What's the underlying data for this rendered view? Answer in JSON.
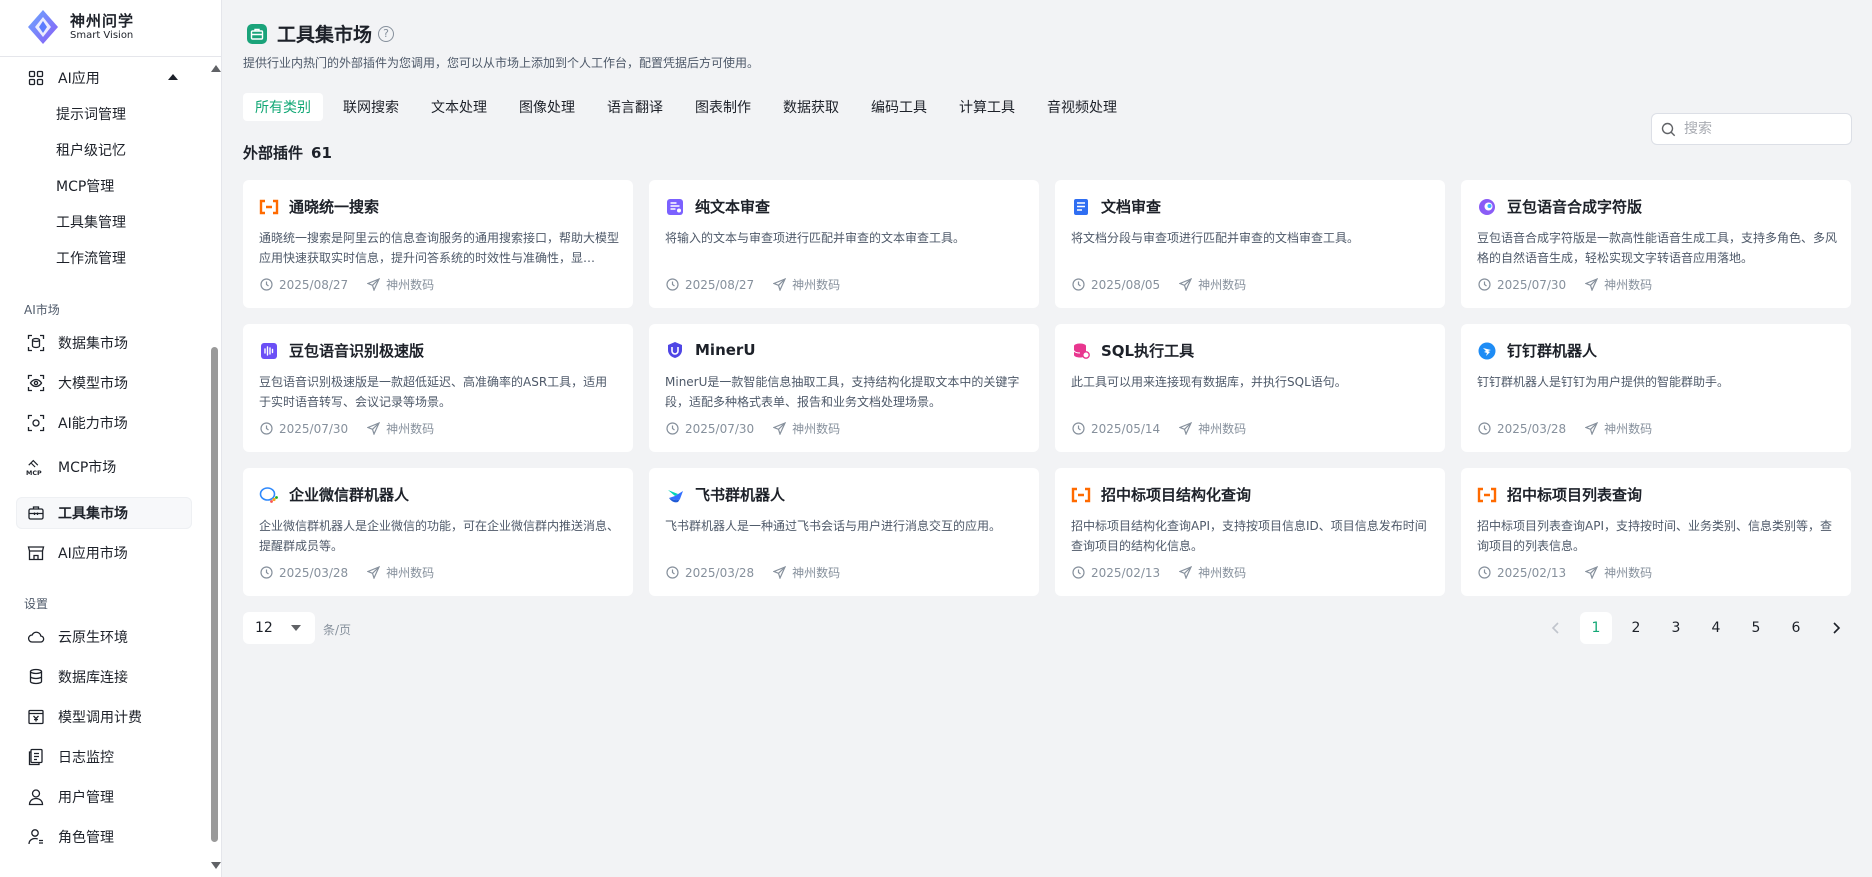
{
  "brand": {
    "name": "神州问学",
    "sub": "Smart Vision"
  },
  "sidebar": {
    "ai_app": {
      "label": "AI应用",
      "children": [
        "提示词管理",
        "租户级记忆",
        "MCP管理",
        "工具集管理",
        "工作流管理"
      ]
    },
    "market_section": "AI市场",
    "market_items": [
      "数据集市场",
      "大模型市场",
      "AI能力市场",
      "MCP市场",
      "工具集市场",
      "AI应用市场"
    ],
    "settings_section": "设置",
    "settings_items": [
      "云原生环境",
      "数据库连接",
      "模型调用计费",
      "日志监控",
      "用户管理",
      "角色管理"
    ]
  },
  "header": {
    "title": "工具集市场",
    "help": "?",
    "description": "提供行业内热门的外部插件为您调用，您可以从市场上添加到个人工作台，配置凭据后方可使用。"
  },
  "tabs": [
    "所有类别",
    "联网搜索",
    "文本处理",
    "图像处理",
    "语言翻译",
    "图表制作",
    "数据获取",
    "编码工具",
    "计算工具",
    "音视频处理"
  ],
  "search": {
    "placeholder": "搜索"
  },
  "summary": {
    "label": "外部插件",
    "count": "61"
  },
  "cards": [
    {
      "name": "通晓统一搜索",
      "icon": "aliyun-icon",
      "color": "#ff6a00",
      "desc": "通晓统一搜索是阿里云的信息查询服务的通用搜索接口，帮助大模型应用快速获取实时信息，提升问答系统的时效性与准确性，显…",
      "date": "2025/08/27",
      "author": "神州数码"
    },
    {
      "name": "纯文本审查",
      "icon": "text-review-icon",
      "color": "#7b61ff",
      "desc": "将输入的文本与审查项进行匹配并审查的文本审查工具。",
      "date": "2025/08/27",
      "author": "神州数码"
    },
    {
      "name": "文档审查",
      "icon": "document-review-icon",
      "color": "#2f6ef2",
      "desc": "将文档分段与审查项进行匹配并审查的文档审查工具。",
      "date": "2025/08/05",
      "author": "神州数码"
    },
    {
      "name": "豆包语音合成字符版",
      "icon": "doubao-icon",
      "color": "#8a5cf6",
      "desc": "豆包语音合成字符版是一款高性能语音生成工具，支持多角色、多风格的自然语音生成，轻松实现文字转语音应用落地。",
      "date": "2025/07/30",
      "author": "神州数码"
    },
    {
      "name": "豆包语音识别极速版",
      "icon": "voice-wave-icon",
      "color": "#6b4ff6",
      "desc": "豆包语音识别极速版是一款超低延迟、高准确率的ASR工具，适用于实时语音转写、会议记录等场景。",
      "date": "2025/07/30",
      "author": "神州数码"
    },
    {
      "name": "MinerU",
      "icon": "mineru-icon",
      "color": "#4f46e5",
      "desc": "MinerU是一款智能信息抽取工具，支持结构化提取文本中的关键字段，适配多种格式表单、报告和业务文档处理场景。",
      "date": "2025/07/30",
      "author": "神州数码"
    },
    {
      "name": "SQL执行工具",
      "icon": "database-icon",
      "color": "#e8368f",
      "desc": "此工具可以用来连接现有数据库，并执行SQL语句。",
      "date": "2025/05/14",
      "author": "神州数码"
    },
    {
      "name": "钉钉群机器人",
      "icon": "dingtalk-icon",
      "color": "#1e8cf5",
      "desc": "钉钉群机器人是钉钉为用户提供的智能群助手。",
      "date": "2025/03/28",
      "author": "神州数码"
    },
    {
      "name": "企业微信群机器人",
      "icon": "wecom-icon",
      "color": "#1aad19",
      "desc": "企业微信群机器人是企业微信的功能，可在企业微信群内推送消息、提醒群成员等。",
      "date": "2025/03/28",
      "author": "神州数码"
    },
    {
      "name": "飞书群机器人",
      "icon": "feishu-icon",
      "color": "#3370ff",
      "desc": "飞书群机器人是一种通过飞书会话与用户进行消息交互的应用。",
      "date": "2025/03/28",
      "author": "神州数码"
    },
    {
      "name": "招中标项目结构化查询",
      "icon": "aliyun-icon",
      "color": "#ff6a00",
      "desc": "招中标项目结构化查询API，支持按项目信息ID、项目信息发布时间查询项目的结构化信息。",
      "date": "2025/02/13",
      "author": "神州数码"
    },
    {
      "name": "招中标项目列表查询",
      "icon": "aliyun-icon",
      "color": "#ff6a00",
      "desc": "招中标项目列表查询API，支持按时间、业务类别、信息类别等，查询项目的列表信息。",
      "date": "2025/02/13",
      "author": "神州数码"
    }
  ],
  "pagination": {
    "page_size": "12",
    "per_page_label": "条/页",
    "pages": [
      "1",
      "2",
      "3",
      "4",
      "5",
      "6"
    ],
    "current": "1"
  },
  "colors": {
    "accent": "#13a876",
    "title_icon": "#1aa37a",
    "background": "#f2f3f5"
  }
}
